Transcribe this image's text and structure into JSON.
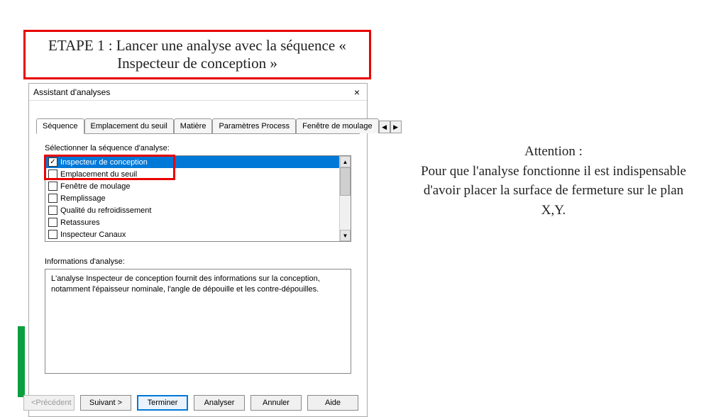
{
  "step_title": "ETAPE 1 : Lancer une analyse avec la séquence « Inspecteur de conception »",
  "dialog": {
    "title": "Assistant d'analyses",
    "close": "×",
    "tabs": {
      "t0": "Séquence",
      "t1": "Emplacement du seuil",
      "t2": "Matière",
      "t3": "Paramètres Process",
      "t4": "Fenêtre de moulage",
      "scroll_left": "◀",
      "scroll_right": "▶"
    },
    "section_select_label": "Sélectionner la séquence d'analyse:",
    "sequence_items": {
      "i0": "Inspecteur de conception",
      "i1": "Emplacement du seuil",
      "i2": "Fenêtre de moulage",
      "i3": "Remplissage",
      "i4": "Qualité du refroidissement",
      "i5": "Retassures",
      "i6": "Inspecteur Canaux"
    },
    "info_label": "Informations d'analyse:",
    "info_text": "L'analyse Inspecteur de conception fournit des informations sur la conception, notamment l'épaisseur nominale, l'angle de dépouille et les contre-dépouilles.",
    "buttons": {
      "prev": "<Précédent",
      "next": "Suivant >",
      "finish": "Terminer",
      "analyze": "Analyser",
      "cancel": "Annuler",
      "help": "Aide"
    },
    "scroll": {
      "up": "▲",
      "down": "▼"
    }
  },
  "side_note": "Attention :\nPour que l'analyse fonctionne il est indispensable d'avoir placer la surface de fermeture sur le plan X,Y."
}
